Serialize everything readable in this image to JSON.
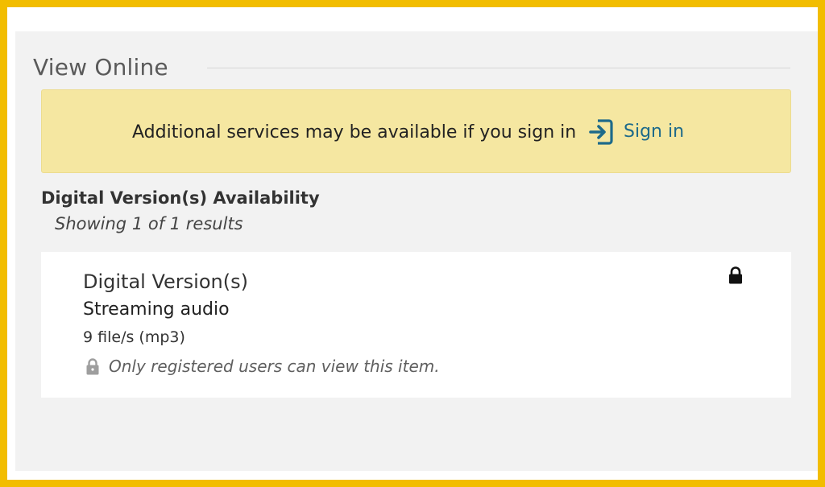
{
  "section": {
    "title": "View Online"
  },
  "banner": {
    "message": "Additional services may be available if you sign in",
    "signin_label": "Sign in",
    "signin_icon": "sign-in-icon"
  },
  "availability": {
    "title": "Digital Version(s) Availability",
    "count": "Showing 1 of 1 results"
  },
  "result": {
    "title": "Digital Version(s)",
    "type": "Streaming audio",
    "files": "9 file/s (mp3)",
    "restriction": "Only registered users can view this item.",
    "lock_icon": "lock-icon"
  },
  "colors": {
    "frame": "#f2bd00",
    "panel": "#f2f2f2",
    "banner": "#f5e7a1",
    "link": "#1d6a8a"
  }
}
